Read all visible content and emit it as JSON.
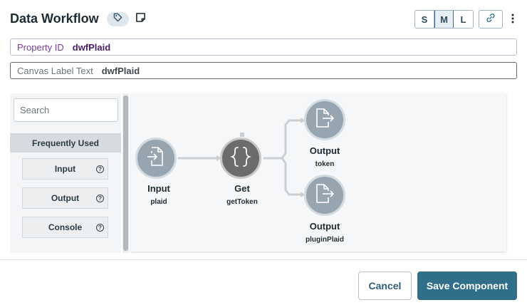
{
  "header": {
    "title": "Data Workflow",
    "size_options": [
      "S",
      "M",
      "L"
    ],
    "selected_size": "M"
  },
  "fields": {
    "property_id": {
      "label": "Property ID",
      "value": "dwfPlaid"
    },
    "canvas_label": {
      "label": "Canvas Label Text",
      "value": "dwfPlaid"
    }
  },
  "palette": {
    "search_placeholder": "Search",
    "category": "Frequently Used",
    "items": [
      {
        "label": "Input",
        "help": "?"
      },
      {
        "label": "Output",
        "help": "?"
      },
      {
        "label": "Console",
        "help": "?"
      }
    ]
  },
  "canvas": {
    "nodes": [
      {
        "title": "Input",
        "sub": "plaid",
        "icon": "input-file-icon"
      },
      {
        "title": "Get",
        "sub": "getToken",
        "icon": "curly-braces-icon"
      },
      {
        "title": "Output",
        "sub": "token",
        "icon": "output-file-icon"
      },
      {
        "title": "Output",
        "sub": "pluginPlaid",
        "icon": "output-file-icon"
      }
    ]
  },
  "footer": {
    "cancel_label": "Cancel",
    "save_label": "Save Component"
  },
  "colors": {
    "accent": "#2f6f8a",
    "node_gray": "#97a5b0",
    "node_dark": "#6c6c6c",
    "property_purple": "#7a3e9a"
  }
}
